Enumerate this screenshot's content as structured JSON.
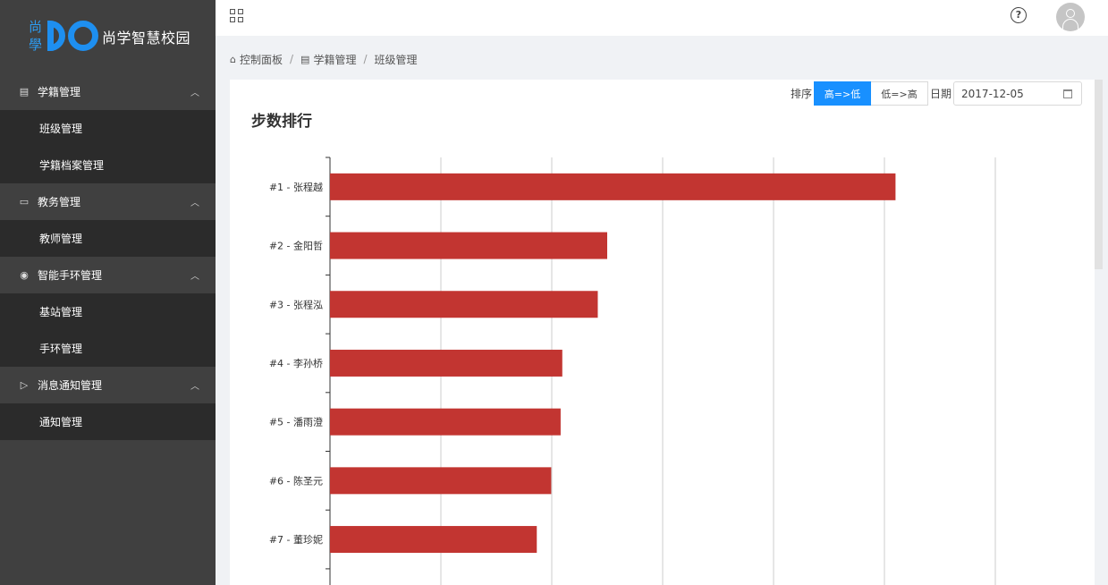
{
  "brand": {
    "logo_char1": "尚",
    "logo_char2": "學",
    "title": "尚学智慧校园"
  },
  "sidebar": {
    "groups": [
      {
        "icon": "student-file-icon",
        "label": "学籍管理",
        "children": [
          "班级管理",
          "学籍档案管理"
        ]
      },
      {
        "icon": "folder-icon",
        "label": "教务管理",
        "children": [
          "教师管理"
        ]
      },
      {
        "icon": "eye-icon",
        "label": "智能手环管理",
        "children": [
          "基站管理",
          "手环管理"
        ]
      },
      {
        "icon": "send-icon",
        "label": "消息通知管理",
        "children": [
          "通知管理"
        ]
      }
    ]
  },
  "header": {
    "help_icon": "question-circle-icon",
    "help_glyph": "?",
    "avatar_icon": "user-avatar-icon"
  },
  "breadcrumb": {
    "items": [
      "控制面板",
      "学籍管理",
      "班级管理"
    ],
    "separator": "/"
  },
  "card": {
    "title": "步数排行",
    "sort_label": "排序",
    "sort_desc": "高=>低",
    "sort_asc": "低=>高",
    "date_label": "日期",
    "date_value": "2017-12-05"
  },
  "colors": {
    "bar": "#c23531",
    "accent": "#1890ff",
    "sidebar": "#404040",
    "sidebar_sub": "#2b2b2b"
  },
  "chart_data": {
    "type": "bar",
    "orientation": "horizontal",
    "categories": [
      "#1 - 张程越",
      "#2 - 金阳哲",
      "#3 - 张程泓",
      "#4 - 李孙桥",
      "#5 - 潘雨澄",
      "#6 - 陈圣元",
      "#7 - 董珍妮"
    ],
    "values": [
      1020,
      500,
      483,
      419,
      416,
      399,
      373
    ],
    "xlim": [
      0,
      1200
    ],
    "grid": true
  }
}
